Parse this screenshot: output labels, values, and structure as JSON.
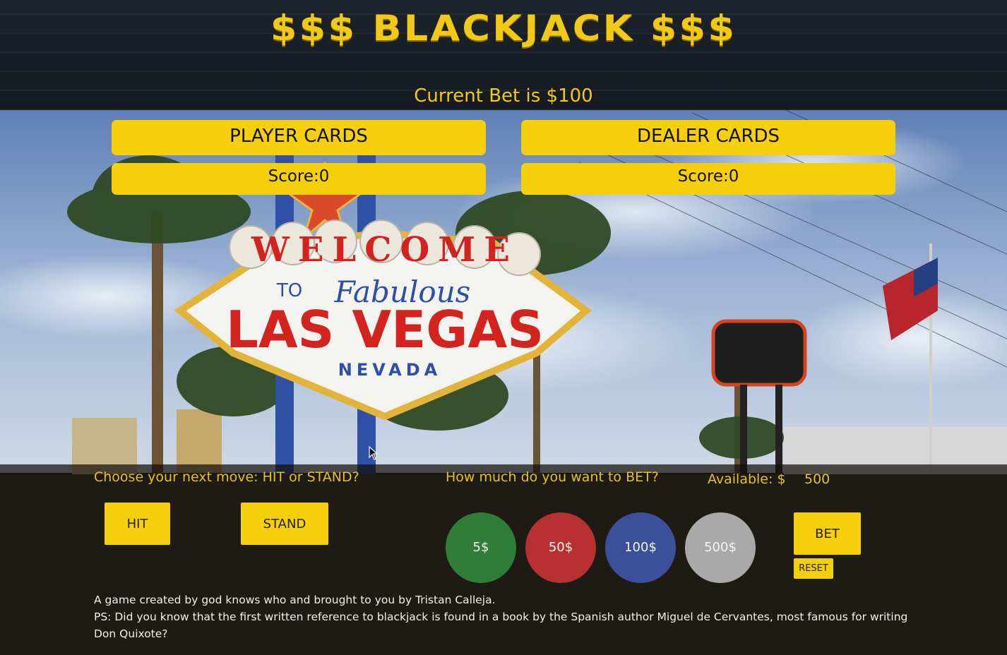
{
  "header": {
    "title": "$$$ BLACKJACK $$$",
    "current_bet_label": "Current Bet is $100"
  },
  "player": {
    "title": "PLAYER CARDS",
    "score": "Score:0"
  },
  "dealer": {
    "title": "DEALER CARDS",
    "score": "Score:0"
  },
  "moves": {
    "prompt": "Choose your next move: HIT or STAND?",
    "hit_label": "HIT",
    "stand_label": "STAND"
  },
  "betting": {
    "prompt": "How much do you want to BET?",
    "available_label": "Available: $",
    "available_value": "500",
    "chips": [
      {
        "label": "5$",
        "color": "#2f7d36"
      },
      {
        "label": "50$",
        "color": "#b8302f"
      },
      {
        "label": "100$",
        "color": "#3b4f9a"
      },
      {
        "label": "500$",
        "color": "#a9a9a9"
      }
    ],
    "bet_label": "BET",
    "reset_label": "RESET"
  },
  "footer": {
    "line1": "A game created by god knows who and brought to you by Tristan Calleja.",
    "line2": "PS: Did you know that the first written reference to blackjack is found in a book by the Spanish author Miguel de Cervantes, most famous for writing Don Quixote?"
  },
  "background_sign": {
    "welcome": "WELCOME",
    "to": "TO",
    "fabulous": "Fabulous",
    "city": "LAS VEGAS",
    "state": "NEVADA"
  },
  "colors": {
    "accent": "#f5cf0a",
    "header_text": "#f2c916",
    "header_bg": "#1b2129"
  }
}
